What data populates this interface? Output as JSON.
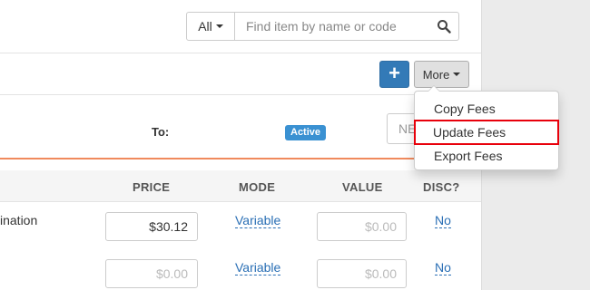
{
  "search": {
    "scope_value": "All",
    "placeholder": "Find item by name or code",
    "icon": "search-icon"
  },
  "toolbar": {
    "add_label": "+",
    "more_label": "More"
  },
  "filters": {
    "to_label": "To:",
    "status_badge": "Active",
    "partial_field_text": "NE"
  },
  "table": {
    "headers": [
      "PRICE",
      "MODE",
      "VALUE",
      "DISC?"
    ],
    "rows": [
      {
        "name": "ination",
        "price": "$30.12",
        "mode": "Variable",
        "value": "$0.00",
        "disc": "No"
      },
      {
        "name": "",
        "price": "$0.00",
        "mode": "Variable",
        "value": "$0.00",
        "disc": "No"
      }
    ]
  },
  "more_menu": {
    "items": [
      {
        "label": "Copy Fees"
      },
      {
        "label": "Update Fees",
        "highlighted": true
      },
      {
        "label": "Export Fees"
      }
    ]
  },
  "colors": {
    "primary": "#337ab7",
    "badge": "#3a91d2",
    "link": "#2a6fb5",
    "accent_rule": "#f08a5d",
    "highlight_outline": "#e8000b"
  }
}
